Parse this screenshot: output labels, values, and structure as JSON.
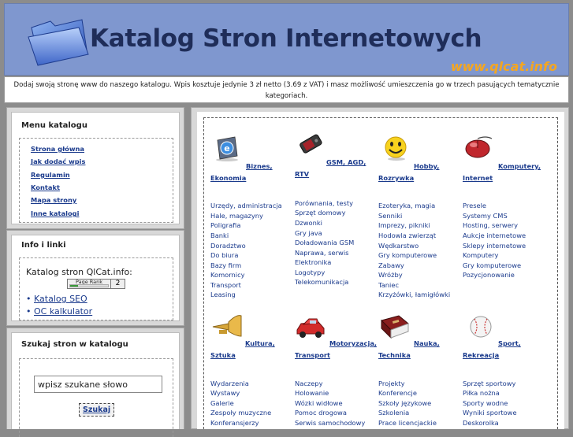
{
  "header": {
    "title": "Katalog Stron Internetowych",
    "url": "www.qlcat.info"
  },
  "notice": {
    "line1": "Dodaj swoją stronę www do naszego katalogu. Wpis kosztuje jedynie 3 zł netto (3.69 z VAT) i masz możliwość umieszczenia go w trzech pasujących tematycznie",
    "line2": "kategoriach."
  },
  "sidebar": {
    "menu": {
      "title": "Menu katalogu",
      "items": [
        "Strona główna",
        "Jak dodać wpis",
        "Regulamin",
        "Kontakt",
        "Mapa strony",
        "Inne katalogi"
      ]
    },
    "info": {
      "title": "Info i linki",
      "text": "Katalog stron QlCat.info:",
      "pagerank_label": "Page Rank",
      "pagerank_value": "2",
      "links": [
        "Katalog SEO",
        "OC kalkulator"
      ]
    },
    "search": {
      "title": "Szukaj stron w katalogu",
      "placeholder": "wpisz szukane słowo",
      "button": "Szukaj"
    }
  },
  "categories": [
    {
      "icon": "ie-logo-icon",
      "title_a": "Biznes,",
      "title_b": "Ekonomia",
      "subs": [
        "Urzędy, administracja",
        "Hale, magazyny",
        "Poligrafia",
        "Banki",
        "Doradztwo",
        "Do biura",
        "Bazy firm",
        "Komornicy",
        "Transport",
        "Leasing"
      ]
    },
    {
      "icon": "mobile-phone-icon",
      "title_a": "GSM, AGD,",
      "title_b": "RTV",
      "subs": [
        "Porównania, testy",
        "Sprzęt domowy",
        "Dzwonki",
        "Gry java",
        "Doładowania GSM",
        "Naprawa, serwis",
        "Elektronika",
        "Logotypy",
        "Telekomunikacja"
      ]
    },
    {
      "icon": "smiley-icon",
      "title_a": "Hobby,",
      "title_b": "Rozrywka",
      "subs": [
        "Ezoteryka, magia",
        "Senniki",
        "Imprezy, pikniki",
        "Hodowla zwierząt",
        "Wędkarstwo",
        "Gry komputerowe",
        "Zabawy",
        "Wróżby",
        "Taniec",
        "Krzyżówki, łamigłówki"
      ]
    },
    {
      "icon": "computer-mouse-icon",
      "title_a": "Komputery,",
      "title_b": "Internet",
      "subs": [
        "Presele",
        "Systemy CMS",
        "Hosting, serwery",
        "Aukcje internetowe",
        "Sklepy internetowe",
        "Komputery",
        "Gry komputerowe",
        "Pozycjonowanie"
      ]
    },
    {
      "icon": "trumpet-icon",
      "title_a": "Kultura,",
      "title_b": "Sztuka",
      "subs": [
        "Wydarzenia",
        "Wystawy",
        "Galerie",
        "Zespoły muzyczne",
        "Konferansjerzy"
      ]
    },
    {
      "icon": "car-icon",
      "title_a": "Motoryzacja,",
      "title_b": "Transport",
      "subs": [
        "Naczepy",
        "Holowanie",
        "Wózki widłowe",
        "Pomoc drogowa",
        "Serwis samochodowy"
      ]
    },
    {
      "icon": "book-icon",
      "title_a": "Nauka,",
      "title_b": "Technika",
      "subs": [
        "Projekty",
        "Konferencje",
        "Szkoły językowe",
        "Szkolenia",
        "Prace licencjackie"
      ]
    },
    {
      "icon": "baseball-icon",
      "title_a": "Sport,",
      "title_b": "Rekreacja",
      "subs": [
        "Sprzęt sportowy",
        "Piłka nożna",
        "Sporty wodne",
        "Wyniki sportowe",
        "Deskorolka"
      ]
    }
  ]
}
